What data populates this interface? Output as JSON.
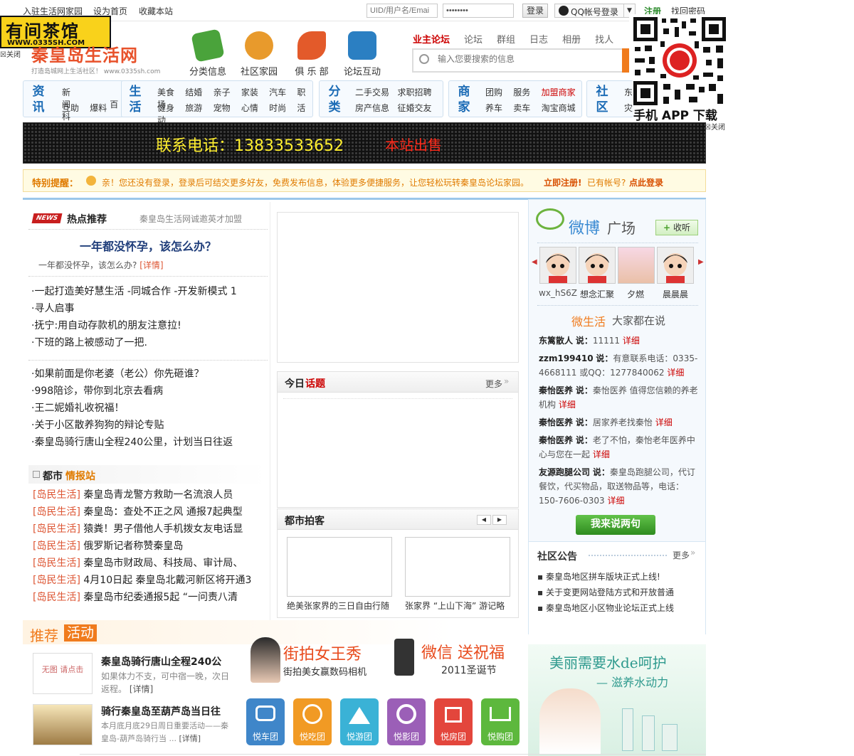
{
  "topbar": {
    "links": [
      "入驻生活网家园",
      "设为首页",
      "收藏本站"
    ],
    "user_placeholder": "UID/用户名/Emai",
    "password_value": "••••••••",
    "login_btn": "登录",
    "qq_login": "QQ帐号登录",
    "register": "注册",
    "forgot": "找回密码"
  },
  "float_ad": {
    "title": "有间茶馆",
    "url": "WWW.0335SH.COM",
    "close": "关闭"
  },
  "qr": {
    "caption": "手机 APP 下载",
    "close": "关闭"
  },
  "logo": {
    "name": "秦皇岛生活网",
    "slogan": "打造岛城网上生活社区！ www.0335sh.com"
  },
  "nav_icons": [
    {
      "label": "分类信息",
      "color": "#4aa33b"
    },
    {
      "label": "社区家园",
      "color": "#e89a2c"
    },
    {
      "label": "俱 乐 部",
      "color": "#e35a2a"
    },
    {
      "label": "论坛互动",
      "color": "#2b7fc2"
    }
  ],
  "tabs": [
    "业主论坛",
    "论坛",
    "群组",
    "日志",
    "相册",
    "找人"
  ],
  "search": {
    "placeholder": "输入您要搜索的信息"
  },
  "categories": [
    {
      "title": [
        "资",
        "讯"
      ],
      "row1": [
        "新闻",
        "百科"
      ],
      "row2": [
        "互助",
        "爆料"
      ]
    },
    {
      "title": [
        "生",
        "活"
      ],
      "row1": [
        "美食",
        "结婚",
        "亲子",
        "家装",
        "汽车",
        "职场"
      ],
      "row2": [
        "健身",
        "旅游",
        "宠物",
        "心情",
        "时尚",
        "活动"
      ]
    },
    {
      "title": [
        "分",
        "类"
      ],
      "row1": [
        "二手交易",
        "求职招聘"
      ],
      "row2": [
        "房产信息",
        "征婚交友"
      ]
    },
    {
      "title": [
        "商",
        "家"
      ],
      "row1": [
        "团购",
        "服务",
        "加盟商家"
      ],
      "row2": [
        "养车",
        "卖车",
        "淘宝商城"
      ]
    },
    {
      "title": [
        "社",
        "区"
      ],
      "row1": [
        "东"
      ],
      "row2": [
        "灾"
      ]
    }
  ],
  "banner": {
    "phone": "联系电话：13833533652",
    "sale": "本站出售"
  },
  "notice": {
    "label": "特别提醒：",
    "text": "亲！您还没有登录，登录后可结交更多好友，免费发布信息，体验更多便捷服务，让您轻松玩转秦皇岛论坛家园。",
    "register": "立即注册!",
    "has_account": "已有帐号?",
    "login": "点此登录"
  },
  "hot": {
    "title": "热点推荐",
    "news_badge": "NEWS",
    "invite": "秦皇岛生活网诚邀英才加盟",
    "headline": "一年都没怀孕，该怎么办？",
    "summary": "一年都没怀孕，该怎么办?",
    "detail": "[详情]",
    "list1": [
      "·一起打造美好慧生活 -同城合作 -开发新模式 1",
      "·寻人启事",
      "·抚宁:用自动存款机的朋友注意拉!",
      "·下班的路上被感动了一把."
    ],
    "list2": [
      "·如果前面是你老婆（老公）你先砸谁？",
      "·998陪诊，带你到北京去看病",
      "·王二妮婚礼收祝福！",
      "·关于小区散养狗狗的辩论专贴",
      "·秦皇岛骑行唐山全程240公里，计划当日往返"
    ]
  },
  "city": {
    "title_a": "都市",
    "title_b": "情报站",
    "tag": "[岛民生活]",
    "items": [
      "秦皇岛青龙警方救助一名流浪人员",
      "秦皇岛：查处不正之风 通报7起典型",
      "猿粪！男子借他人手机拨女友电话显",
      "俄罗斯记者称赞秦皇岛",
      "秦皇岛市财政局、科技局、审计局、",
      "4月10日起 秦皇岛北戴河新区将开通3",
      "秦皇岛市纪委通报5起 “一问责八清"
    ]
  },
  "topic": {
    "title_a": "今日",
    "title_b": "话题",
    "more": "更多"
  },
  "photo": {
    "title": "都市拍客",
    "items": [
      "绝美张家界的三日自由行随",
      "张家界 “上山下海” 游记略"
    ]
  },
  "activity": {
    "title_a": "推荐",
    "title_b": "活动",
    "items": [
      {
        "thumb": "无图 请点击",
        "title": "秦皇岛骑行唐山全程240公",
        "desc": "如果体力不支，可中宿一晚，次日返程。",
        "detail": "[详情]"
      },
      {
        "thumb": "",
        "title": "骑行秦皇岛至葫芦岛当日往",
        "desc": "本月底月底29日周日重要活动——秦皇岛-葫芦岛骑行当 ...",
        "detail": "[详情]"
      }
    ]
  },
  "promo": {
    "street_title": "街拍女王秀",
    "street_sub": "街拍美女赢数码相机",
    "wechat_title": "微信 送祝福",
    "wechat_sub": "2011圣诞节"
  },
  "groupbuy": [
    {
      "label": "悦车团",
      "color": "#3f86c9"
    },
    {
      "label": "悦吃团",
      "color": "#f19a24"
    },
    {
      "label": "悦游团",
      "color": "#3ab2d6"
    },
    {
      "label": "悦影团",
      "color": "#9b5fb7"
    },
    {
      "label": "悦房团",
      "color": "#e3463c"
    },
    {
      "label": "悦购团",
      "color": "#5db83d"
    }
  ],
  "weibo": {
    "title_a": "微博",
    "title_b": "广场",
    "listen": "收听",
    "avatars": [
      "wx_hS6Z",
      "想念汇聚",
      "夕燃",
      "晨晨晨"
    ],
    "say_a": "微生活",
    "say_b": "大家都在说",
    "posts": [
      {
        "user": "东篱散人",
        "text": "11111",
        "detail": "详细"
      },
      {
        "user": "zzm199410",
        "text": "有意联系电话：0335-4668111 或QQ：1277840062",
        "detail": "详细"
      },
      {
        "user": "秦怡医养",
        "text": "秦怡医养 值得您信赖的养老机构",
        "detail": "详细"
      },
      {
        "user": "秦怡医养",
        "text": "居家养老找秦怡",
        "detail": "详细"
      },
      {
        "user": "秦怡医养",
        "text": "老了不怕，秦怡老年医养中心与您在一起",
        "detail": "详细"
      },
      {
        "user": "友源跑腿公司",
        "text": "秦皇岛跑腿公司，代订餐饮，代买物品，取送物品等，电话：150-7606-0303",
        "detail": "详细"
      }
    ],
    "say_btn": "我来说两句"
  },
  "announce": {
    "title": "社区公告",
    "more": "更多",
    "items": [
      "秦皇岛地区拼车版块正式上线!",
      "关于变更网站登陆方式和开放普通",
      "秦皇岛地区小区物业论坛正式上线"
    ]
  },
  "ad": {
    "line1": "美丽需要水de呵护",
    "line2": "— 滋养水动力"
  },
  "say_word": "说："
}
